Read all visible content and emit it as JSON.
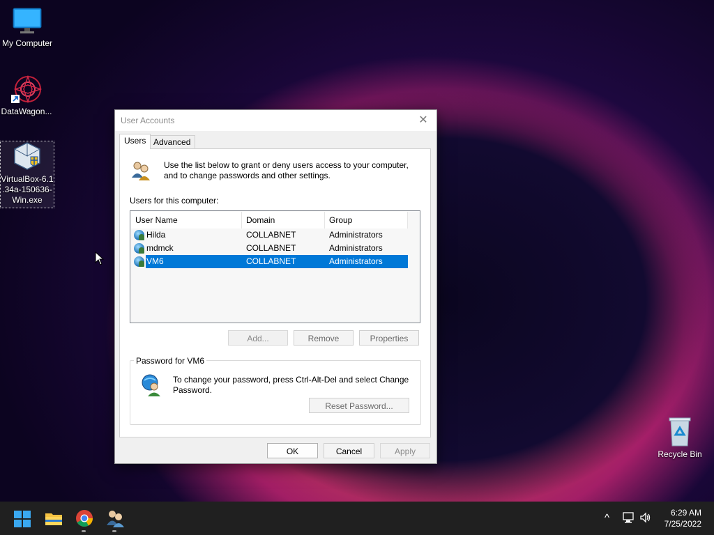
{
  "desktop": {
    "icons": [
      {
        "label": "My Computer"
      },
      {
        "label": "DataWagon..."
      },
      {
        "label_lines": [
          "VirtualBox-6.1",
          ".34a-150636-",
          "Win.exe"
        ]
      },
      {
        "label": "Recycle Bin"
      }
    ]
  },
  "dialog": {
    "title": "User Accounts",
    "close_glyph": "✕",
    "tabs": [
      {
        "label": "Users"
      },
      {
        "label": "Advanced"
      }
    ],
    "info_text": "Use the list below to grant or deny users access to your computer, and to change passwords and other settings.",
    "users_label": "Users for this computer:",
    "columns": [
      "User Name",
      "Domain",
      "Group"
    ],
    "users": [
      {
        "name": "Hilda",
        "domain": "COLLABNET",
        "group": "Administrators"
      },
      {
        "name": "mdmck",
        "domain": "COLLABNET",
        "group": "Administrators"
      },
      {
        "name": "VM6",
        "domain": "COLLABNET",
        "group": "Administrators",
        "selected": true
      }
    ],
    "add_button": "Add...",
    "remove_button": "Remove",
    "properties_button": "Properties",
    "password_group": "Password for VM6",
    "password_text": "To change your password, press Ctrl-Alt-Del and select Change Password.",
    "reset_button": "Reset Password...",
    "ok_button": "OK",
    "cancel_button": "Cancel",
    "apply_button": "Apply"
  },
  "taskbar": {
    "items": [
      "start-icon",
      "file-explorer-icon",
      "chrome-icon",
      "user-accounts-icon"
    ],
    "time": "6:29 AM",
    "date": "7/25/2022",
    "tray_chevron": "^"
  },
  "colors": {
    "selection": "#0078d7",
    "taskbar": "#202020"
  }
}
